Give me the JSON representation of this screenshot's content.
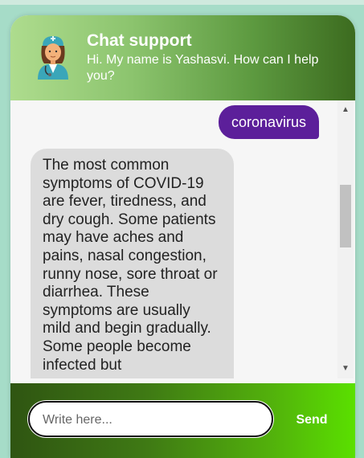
{
  "header": {
    "title": "Chat support",
    "subtitle": "Hi. My name is Yashasvi. How can I help you?",
    "avatar_icon": "doctor-avatar-icon"
  },
  "messages": [
    {
      "from": "user",
      "text": "coronavirus"
    },
    {
      "from": "bot",
      "text": "The most common symptoms of COVID-19 are fever, tiredness, and dry cough. Some patients may have aches and pains, nasal congestion, runny nose, sore throat or diarrhea. These symptoms are usually mild and begin gradually. Some people become infected but"
    }
  ],
  "composer": {
    "placeholder": "Write here...",
    "value": "",
    "send_label": "Send"
  },
  "colors": {
    "user_bubble": "#5c1f9a",
    "bot_bubble": "#dcdcdc",
    "page_bg": "#a6dcc8"
  }
}
